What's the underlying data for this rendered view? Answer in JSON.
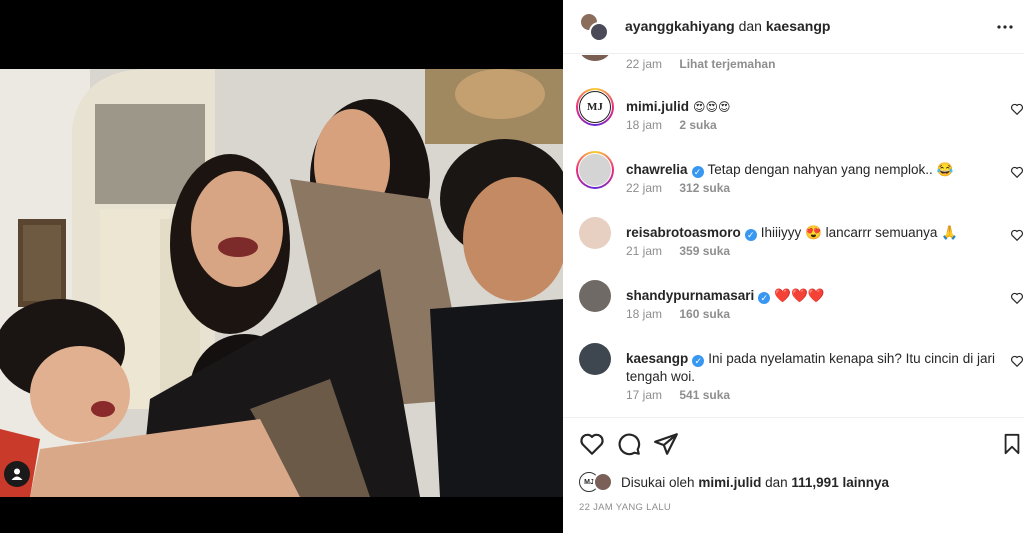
{
  "header": {
    "user1": "ayanggkahiyang",
    "connector": "dan",
    "user2": "kaesangp"
  },
  "first_comment_meta": {
    "time": "22 jam",
    "translate": "Lihat terjemahan"
  },
  "comments": [
    {
      "user": "mimi.julid",
      "verified": false,
      "text": "😍😍😍",
      "time": "18 jam",
      "likes": "2 suka"
    },
    {
      "user": "chawrelia",
      "verified": true,
      "text": "Tetap dengan nahyan yang nemplok.. 😂",
      "time": "22 jam",
      "likes": "312 suka"
    },
    {
      "user": "reisabrotoasmoro",
      "verified": true,
      "text": "Ihiiiyyy 😍 lancarrr semuanya 🙏",
      "time": "21 jam",
      "likes": "359 suka"
    },
    {
      "user": "shandypurnamasari",
      "verified": true,
      "text": "❤️❤️❤️",
      "time": "18 jam",
      "likes": "160 suka"
    },
    {
      "user": "kaesangp",
      "verified": true,
      "text": "Ini pada nyelamatin kenapa sih? Itu cincin di jari tengah woi.",
      "time": "17 jam",
      "likes": "541 suka"
    }
  ],
  "likes": {
    "prefix": "Disukai oleh",
    "user": "mimi.julid",
    "connector": "dan",
    "count": "111,991 lainnya"
  },
  "timestamp": "22 JAM YANG LALU",
  "avatar_badge": "MJ",
  "icons": {
    "more": "more-horizontal-icon",
    "like": "heart-icon",
    "comment": "comment-icon",
    "share": "send-icon",
    "save": "bookmark-icon",
    "tag": "user-tag-icon"
  },
  "colors": {
    "verified": "#3897f0",
    "heart_red": "#ed4956"
  }
}
